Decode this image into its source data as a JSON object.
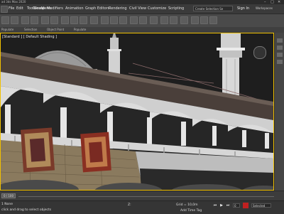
{
  "window": {
    "title": "ad 3ds Max 2020"
  },
  "menubar": {
    "items": [
      "File",
      "Edit",
      "Tools",
      "Group",
      "Views",
      "Create",
      "Modifiers",
      "Animation",
      "Graph Editors",
      "Rendering",
      "Civil View",
      "Customize",
      "Scripting",
      "Interactive"
    ],
    "selection_set": "Create Selection Se",
    "signin": "Sign In",
    "workspace": "Workspaces"
  },
  "ribbon": {
    "tabs": [
      "Populate",
      "Selection",
      "Object Paint",
      "Populate"
    ]
  },
  "viewport": {
    "label": "[Standard ] [ Default Shading ]"
  },
  "statusbar": {
    "selected": "1 None",
    "prompt": "click and drag to select objects",
    "grid_label": "Grid = 10,0m",
    "add_time_tag": "Add Time Tag",
    "selected_dropdown": "Selected",
    "z_label": "Z:",
    "time_value": "0"
  },
  "timeline": {
    "frame": "0 / 100"
  },
  "colors": {
    "accent": "#f0c000",
    "sky": "#1d1d1d"
  }
}
